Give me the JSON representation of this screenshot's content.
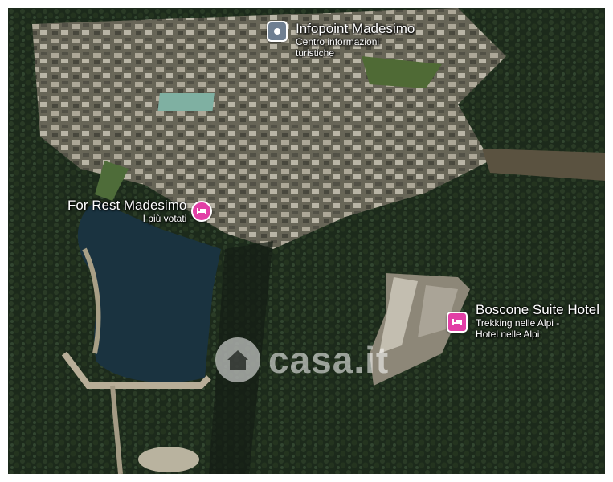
{
  "pois": [
    {
      "title": "Infopoint Madesimo",
      "subtitle": "Centro informazioni turistiche",
      "icon": "info-point-icon"
    },
    {
      "title": "For Rest Madesimo",
      "subtitle": "I più votati",
      "icon": "hotel-bed-icon"
    },
    {
      "title": "Boscone Suite Hotel",
      "subtitle": "Trekking nelle Alpi - Hotel nelle Alpi",
      "icon": "hotel-bed-icon"
    }
  ],
  "watermark": {
    "text": "casa.it",
    "icon": "house-icon"
  },
  "colors": {
    "hotel_pin": "#e23fa6",
    "info_pin": "#6f7f91",
    "lake": "#1c3340",
    "forest": "#1d2a1b"
  }
}
